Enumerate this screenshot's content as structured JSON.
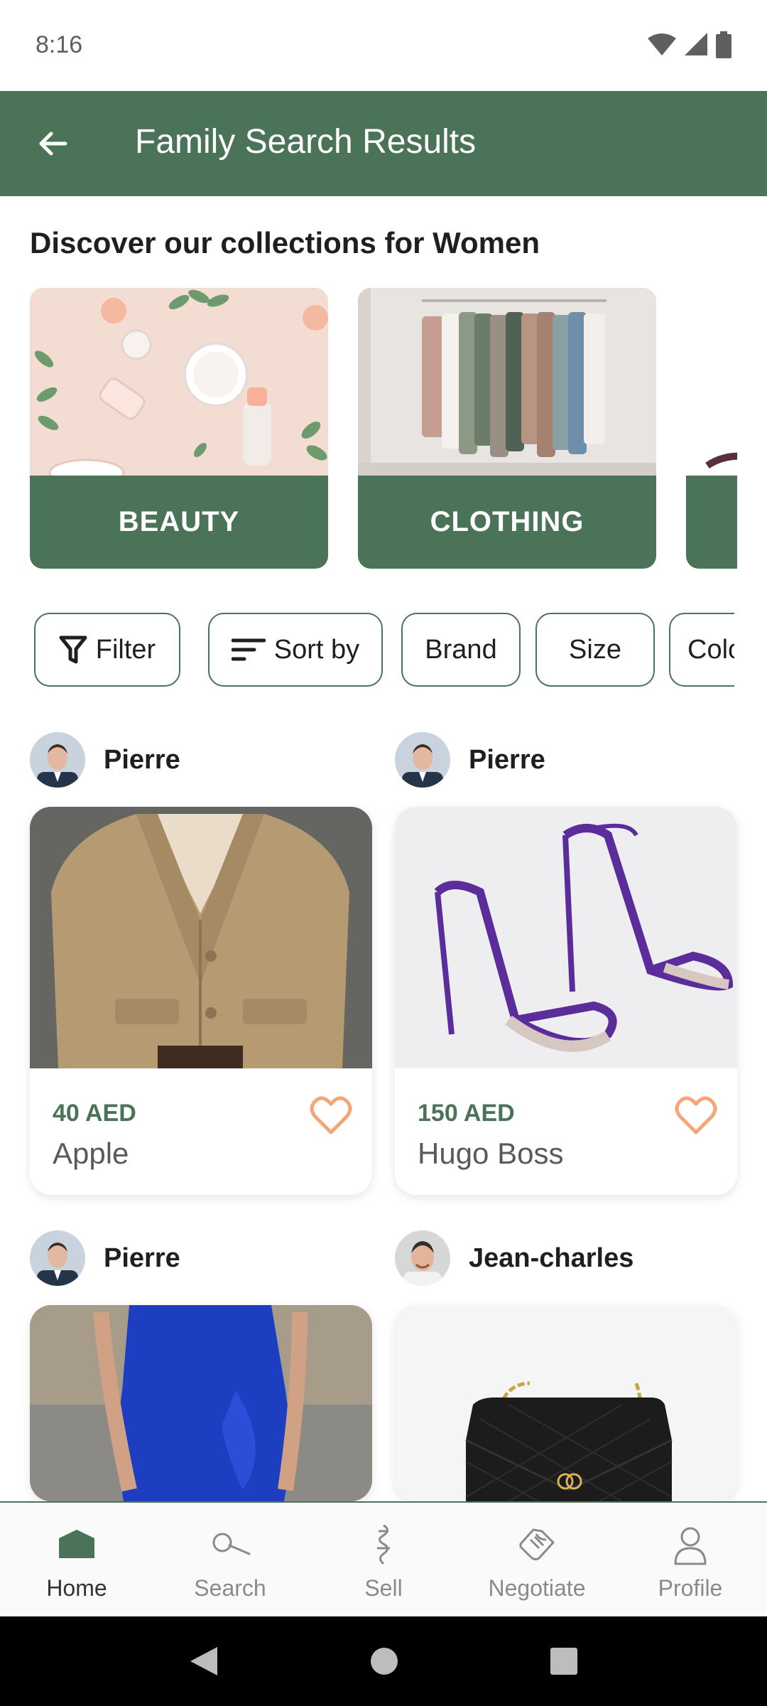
{
  "status_bar": {
    "time": "8:16"
  },
  "app_bar": {
    "title": "Family Search Results"
  },
  "section": {
    "title": "Discover our collections for Women"
  },
  "categories": [
    {
      "label": "BEAUTY"
    },
    {
      "label": "CLOTHING"
    },
    {
      "label": ""
    }
  ],
  "chips": {
    "filter": "Filter",
    "sort": "Sort by",
    "brand": "Brand",
    "size": "Size",
    "color": "Colo"
  },
  "products": [
    {
      "seller": "Pierre",
      "price": "40 AED",
      "brand": "Apple"
    },
    {
      "seller": "Pierre",
      "price": "150 AED",
      "brand": "Hugo Boss"
    },
    {
      "seller": "Pierre"
    },
    {
      "seller": "Jean-charles"
    }
  ],
  "nav": {
    "home": "Home",
    "search": "Search",
    "sell": "Sell",
    "negotiate": "Negotiate",
    "profile": "Profile"
  },
  "colors": {
    "primary": "#4a7358",
    "heart": "#f2a77a"
  }
}
